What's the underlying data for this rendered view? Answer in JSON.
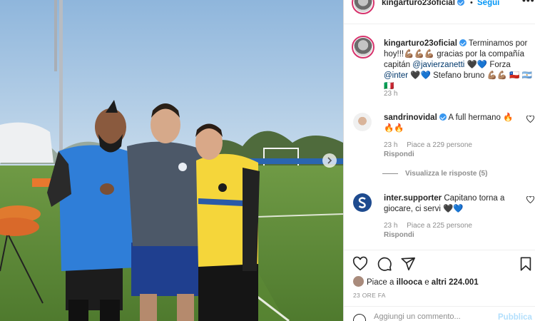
{
  "post": {
    "username": "kingarturo23oficial",
    "dot": "•",
    "follow_label": "Segui",
    "more_label": "•••"
  },
  "caption": {
    "username": "kingarturo23oficial",
    "text_1": "Terminamos por hoy!!!💪🏽💪🏽💪🏽 gracias por la compañía capitán ",
    "mention_1": "@javierzanetti",
    "text_2": " 🖤💙 Forza ",
    "mention_2": "@inter",
    "text_3": " 🖤💙 Stefano bruno 💪🏽💪🏽 🇨🇱 🇦🇷 🇮🇹",
    "time": "23 h"
  },
  "comments": [
    {
      "username": "sandrinovidal",
      "text": "A full hermano 🔥🔥🔥",
      "time": "23 h",
      "likes": "Piace a 229 persone",
      "reply": "Rispondi",
      "avatar_icon": "profile-photo-icon"
    },
    {
      "username": "inter.supporter",
      "text": "Capitano torna a giocare, ci servi 🖤💙",
      "time": "23 h",
      "likes": "Piace a 225 persone",
      "reply": "Rispondi",
      "avatar_icon": "s-logo-icon"
    }
  ],
  "view_replies": "Visualizza le risposte (5)",
  "actions": {
    "icons": [
      "heart-icon",
      "comment-icon",
      "share-icon",
      "bookmark-icon"
    ]
  },
  "likes": {
    "prefix": "Piace a ",
    "user": "illooca",
    "middle": " e ",
    "count": "altri 224.001"
  },
  "post_time": "23 ORE FA",
  "add_comment": {
    "placeholder": "Aggiungi un commento...",
    "publish_label": "Pubblica"
  },
  "colors": {
    "accent": "#0095f6",
    "verified": "#3897f0",
    "story_ring": "#d6336c",
    "muted": "#8e8e8e"
  }
}
